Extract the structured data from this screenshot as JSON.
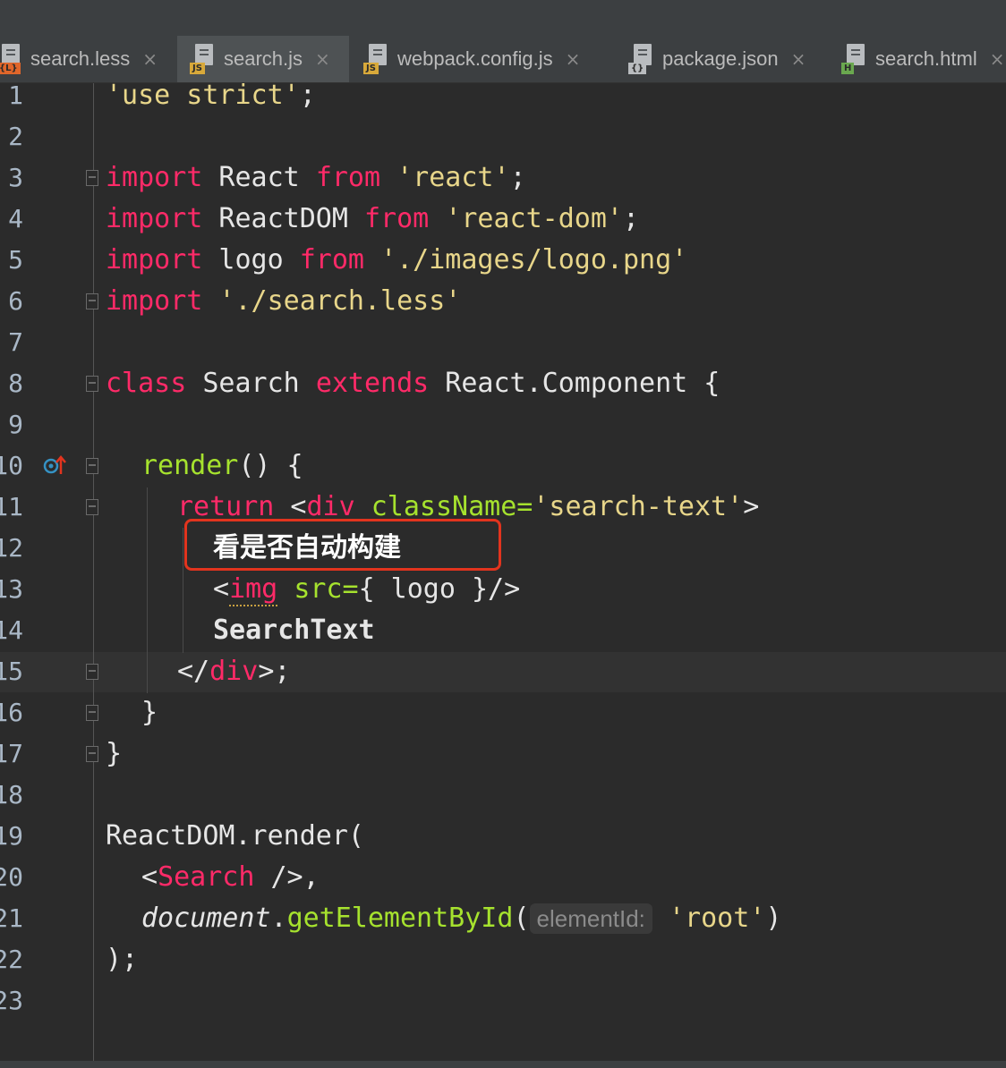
{
  "tabs": [
    {
      "label": "search.less",
      "badge": "{L}",
      "badge_color": "#e0662a",
      "active": false
    },
    {
      "label": "search.js",
      "badge": "JS",
      "badge_color": "#d8a93a",
      "active": true
    },
    {
      "label": "webpack.config.js",
      "badge": "JS",
      "badge_color": "#d8a93a",
      "active": false
    },
    {
      "label": "package.json",
      "badge": "{}",
      "badge_color": "#b9bcbf",
      "active": false
    },
    {
      "label": "search.html",
      "badge": "H",
      "badge_color": "#6aa84f",
      "active": false
    }
  ],
  "close_glyph": "×",
  "line_numbers": [
    "1",
    "2",
    "3",
    "4",
    "5",
    "6",
    "7",
    "8",
    "9",
    "10",
    "11",
    "12",
    "13",
    "14",
    "15",
    "16",
    "17",
    "18",
    "19",
    "20",
    "21",
    "22",
    "23"
  ],
  "code": {
    "l1": {
      "s1": "'use strict'",
      "p1": ";"
    },
    "l3": {
      "k1": "import",
      "p1": " React ",
      "k2": "from",
      "p2": " ",
      "s1": "'react'",
      "p3": ";"
    },
    "l4": {
      "k1": "import",
      "p1": " ReactDOM ",
      "k2": "from",
      "p2": " ",
      "s1": "'react-dom'",
      "p3": ";"
    },
    "l5": {
      "k1": "import",
      "p1": " logo ",
      "k2": "from",
      "p2": " ",
      "s1": "'./images/logo.png'"
    },
    "l6": {
      "k1": "import",
      "p1": " ",
      "s1": "'./search.less'"
    },
    "l8": {
      "k1": "class",
      "p1": " Search ",
      "k2": "extends",
      "p2": " React.Component {"
    },
    "l10": {
      "f1": "render",
      "p1": "() {"
    },
    "l11": {
      "k1": "return",
      "p1": " <",
      "t1": "div",
      "p2": " ",
      "a1": "className=",
      "s1": "'search-text'",
      "p3": ">"
    },
    "l12": {
      "text": "看是否自动构建"
    },
    "l13": {
      "p1": "<",
      "t1": "img",
      "p2": " ",
      "a1": "src=",
      "p3": "{ logo }/>"
    },
    "l14": {
      "text": "SearchText"
    },
    "l15": {
      "p1": "</",
      "t1": "div",
      "p2": ">;"
    },
    "l16": {
      "p1": "}"
    },
    "l17": {
      "p1": "}"
    },
    "l19": {
      "p1": "ReactDOM.render("
    },
    "l20": {
      "p1": "<",
      "t1": "Search",
      "p2": " />,"
    },
    "l21": {
      "o1": "document",
      "p1": ".",
      "f1": "getElementById",
      "p2": "(",
      "hint": "elementId:",
      "p3": " ",
      "s1": "'root'",
      "p4": ")"
    },
    "l22": {
      "p1": ");"
    }
  },
  "colors": {
    "keyword": "#ff2a68",
    "string": "#e8d68a",
    "function": "#a6e22e",
    "highlight": "#e2341e",
    "background": "#2b2b2b"
  }
}
